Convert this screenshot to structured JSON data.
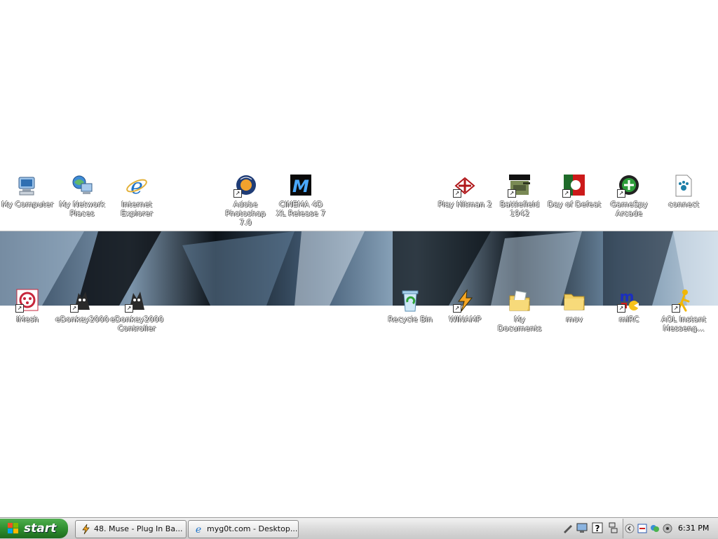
{
  "desktop": {
    "icons": [
      {
        "label": "My Computer",
        "icon": "computer-icon"
      },
      {
        "label": "My Network Places",
        "icon": "network-icon"
      },
      {
        "label": "Internet Explorer",
        "icon": "ie-icon"
      },
      {
        "label": "Adobe Photoshop 7.0",
        "icon": "photoshop-icon"
      },
      {
        "label": "CINEMA 4D XL Release 7",
        "icon": "cinema4d-icon"
      },
      {
        "label": "Play Hitman 2",
        "icon": "hitman-icon"
      },
      {
        "label": "Battlefield 1942",
        "icon": "battlefield-icon"
      },
      {
        "label": "Day of Defeat",
        "icon": "dod-icon"
      },
      {
        "label": "GameSpy Arcade",
        "icon": "gamespy-icon"
      },
      {
        "label": "connect",
        "icon": "document-paw-icon"
      },
      {
        "label": "iMesh",
        "icon": "imesh-icon"
      },
      {
        "label": "eDonkey2000",
        "icon": "edonkey-icon"
      },
      {
        "label": "eDonkey2000 Controller",
        "icon": "edonkey-controller-icon"
      },
      {
        "label": "Recycle Bin",
        "icon": "recycle-bin-icon"
      },
      {
        "label": "WINAMP",
        "icon": "winamp-icon"
      },
      {
        "label": "My Documents",
        "icon": "my-documents-icon"
      },
      {
        "label": "mov",
        "icon": "folder-icon"
      },
      {
        "label": "mIRC",
        "icon": "mirc-icon"
      },
      {
        "label": "AOL Instant Messeng...",
        "icon": "aim-icon"
      }
    ]
  },
  "taskbar": {
    "start_label": "start",
    "tasks": [
      {
        "label": "48. Muse - Plug In Ba...",
        "icon": "winamp-icon"
      },
      {
        "label": "myg0t.com - Desktop...",
        "icon": "ie-icon"
      }
    ],
    "clock": "6:31 PM"
  },
  "colors": {
    "start_green": "#2f8f2f",
    "taskbar_gray": "#d9d9d9",
    "wallpaper_blue": "#7e97ae"
  }
}
